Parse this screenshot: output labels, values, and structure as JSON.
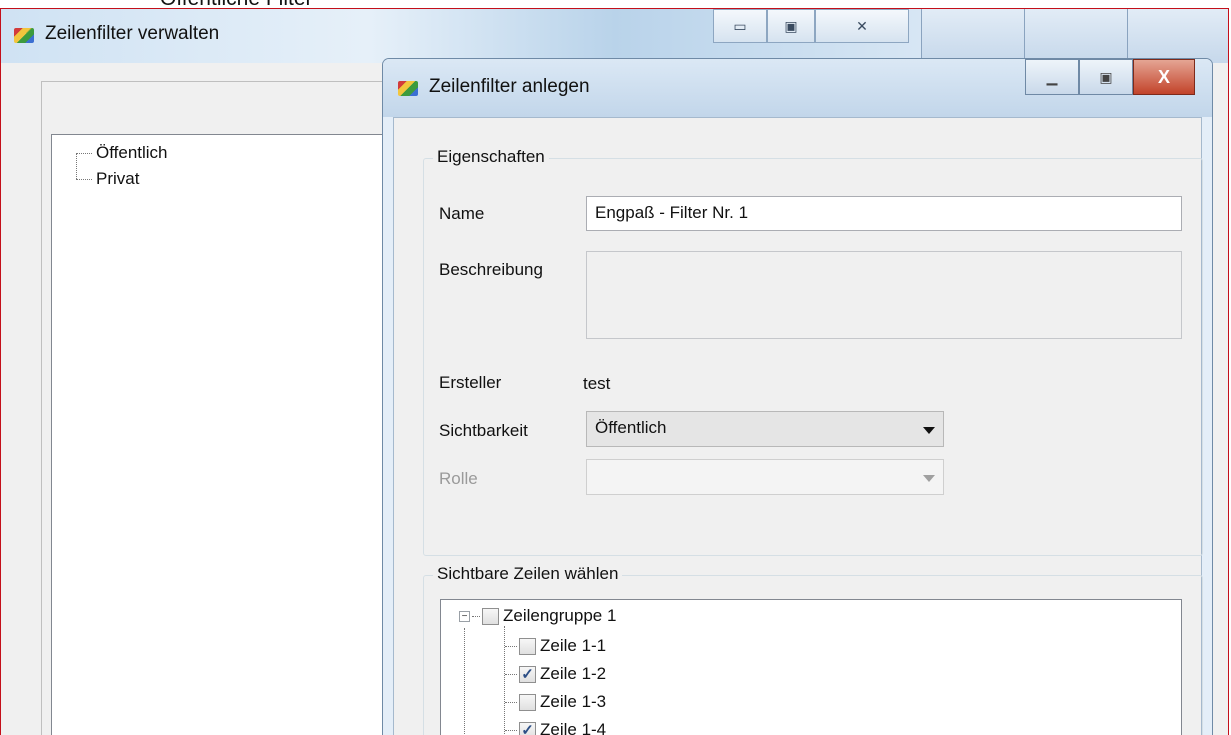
{
  "background": {
    "title_strip": "Öffentliche Filter"
  },
  "back_window": {
    "title": "Zeilenfilter verwalten",
    "controls": {
      "minimize": "▭",
      "maximize": "▣",
      "close": "✕"
    },
    "tree": [
      "Öffentlich",
      "Privat"
    ]
  },
  "front_window": {
    "title": "Zeilenfilter anlegen",
    "controls": {
      "minimize": "▁",
      "maximize": "▣",
      "close": "X"
    },
    "properties": {
      "group_label": "Eigenschaften",
      "name_label": "Name",
      "name_value": "Engpaß - Filter Nr. 1",
      "description_label": "Beschreibung",
      "description_value": "",
      "creator_label": "Ersteller",
      "creator_value": "test",
      "visibility_label": "Sichtbarkeit",
      "visibility_value": "Öffentlich",
      "role_label": "Rolle",
      "role_value": ""
    },
    "rows": {
      "group_label": "Sichtbare Zeilen wählen",
      "items": [
        {
          "label": "Zeilengruppe 1",
          "checked": false,
          "level": 0
        },
        {
          "label": "Zeile 1-1",
          "checked": false,
          "level": 1
        },
        {
          "label": "Zeile 1-2",
          "checked": true,
          "level": 1
        },
        {
          "label": "Zeile 1-3",
          "checked": false,
          "level": 1
        },
        {
          "label": "Zeile 1-4",
          "checked": true,
          "level": 1
        }
      ]
    }
  },
  "icons": [
    "app-icon",
    "minimize-icon",
    "maximize-icon",
    "close-icon",
    "dropdown-arrow-icon",
    "tree-expander-icon",
    "checkbox-icon"
  ]
}
